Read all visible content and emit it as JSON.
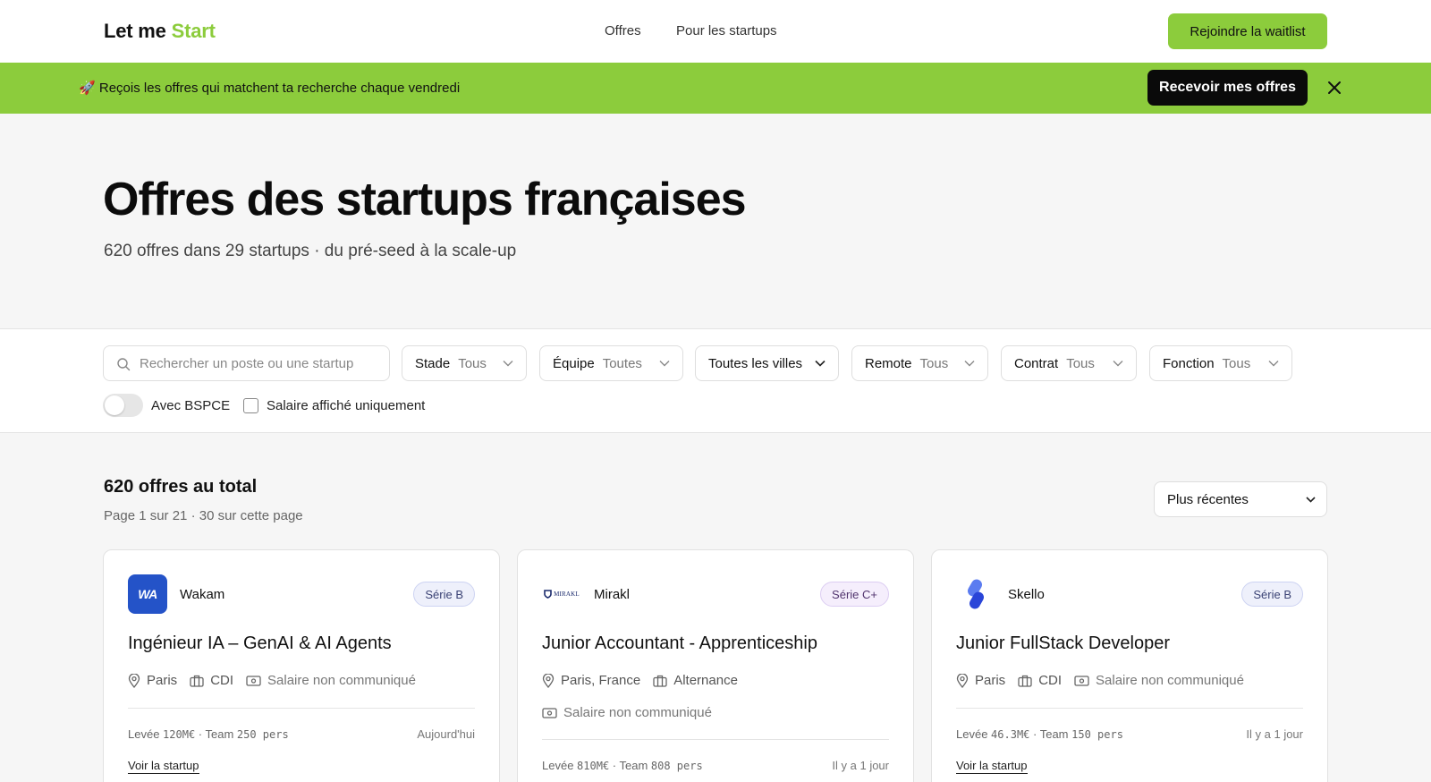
{
  "nav": {
    "logo_main": "Let me",
    "logo_accent": "Start",
    "links": [
      "Offres",
      "Pour les startups"
    ],
    "cta": "Rejoindre la waitlist"
  },
  "banner": {
    "emoji": "🚀",
    "text": "Reçois les offres qui matchent ta recherche chaque vendredi",
    "cta": "Recevoir mes offres"
  },
  "hero": {
    "title": "Offres des startups françaises",
    "subtitle": "620 offres dans 29 startups · du pré-seed à la scale-up"
  },
  "filters": {
    "search_placeholder": "Rechercher un poste ou une startup",
    "stade": {
      "label": "Stade",
      "value": "Tous"
    },
    "equipe": {
      "label": "Équipe",
      "value": "Toutes"
    },
    "villes": {
      "value": "Toutes les villes"
    },
    "remote": {
      "label": "Remote",
      "value": "Tous"
    },
    "contrat": {
      "label": "Contrat",
      "value": "Tous"
    },
    "fonction": {
      "label": "Fonction",
      "value": "Tous"
    },
    "bspce_label": "Avec BSPCE",
    "salary_label": "Salaire affiché uniquement"
  },
  "results": {
    "total": "620 offres au total",
    "page_info": "Page 1 sur 21 · 30 sur cette page",
    "sort": "Plus récentes"
  },
  "cards": [
    {
      "company": "Wakam",
      "logo_text": "WA",
      "stage": "Série B",
      "title": "Ingénieur IA – GenAI & AI Agents",
      "location": "Paris",
      "contract": "CDI",
      "salary": "Salaire non communiqué",
      "funding_prefix": "Levée ",
      "funding": "120M€",
      "team_prefix": " · Team ",
      "team": "250 pers",
      "when": "Aujourd'hui",
      "link": "Voir la startup"
    },
    {
      "company": "Mirakl",
      "logo_text": "MIRAKL",
      "stage": "Série C+",
      "title": "Junior Accountant - Apprenticeship",
      "location": "Paris, France",
      "contract": "Alternance",
      "salary": "Salaire non communiqué",
      "funding_prefix": "Levée ",
      "funding": "810M€",
      "team_prefix": " · Team ",
      "team": "808 pers",
      "when": "Il y a 1 jour"
    },
    {
      "company": "Skello",
      "stage": "Série B",
      "title": "Junior FullStack Developer",
      "location": "Paris",
      "contract": "CDI",
      "salary": "Salaire non communiqué",
      "funding_prefix": "Levée ",
      "funding": "46.3M€",
      "team_prefix": " · Team ",
      "team": "150 pers",
      "when": "Il y a 1 jour",
      "link": "Voir la startup"
    }
  ],
  "colors": {
    "accent": "#8ccc3c",
    "wakam_blue": "#2453c8",
    "skello_blue": "#3357e6"
  }
}
